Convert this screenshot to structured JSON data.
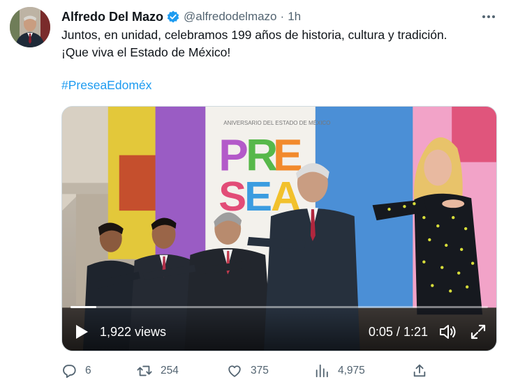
{
  "author": {
    "name": "Alfredo Del Mazo",
    "handle": "@alfredodelmazo",
    "time": "1h",
    "verified": true
  },
  "tweet": {
    "line1": "Juntos, en unidad, celebramos 199 años de historia, cultura y tradición.",
    "line2": "¡Que viva el Estado de México!",
    "hashtag": "#PreseaEdoméx"
  },
  "video": {
    "views": "1,922 views",
    "elapsed": "0:05",
    "separator": "/",
    "total": "1:21",
    "progress": 0.062,
    "banner_letters": [
      "P",
      "R",
      "E",
      "S",
      "E",
      "A"
    ],
    "banner_small_text": "ANIVERSARIO DEL ESTADO DE MÉXICO"
  },
  "stats": {
    "replies": "6",
    "retweets": "254",
    "likes": "375",
    "views": "4,975"
  },
  "icons": {
    "verified": "verified-badge-icon",
    "more": "more-options-icon",
    "reply": "reply-icon",
    "retweet": "retweet-icon",
    "like": "heart-icon",
    "views": "analytics-icon",
    "share": "share-icon",
    "play": "play-icon",
    "volume": "volume-icon",
    "fullscreen": "fullscreen-icon"
  },
  "colors": {
    "accent": "#1d9bf0",
    "muted": "#536471",
    "text": "#0f1419"
  }
}
